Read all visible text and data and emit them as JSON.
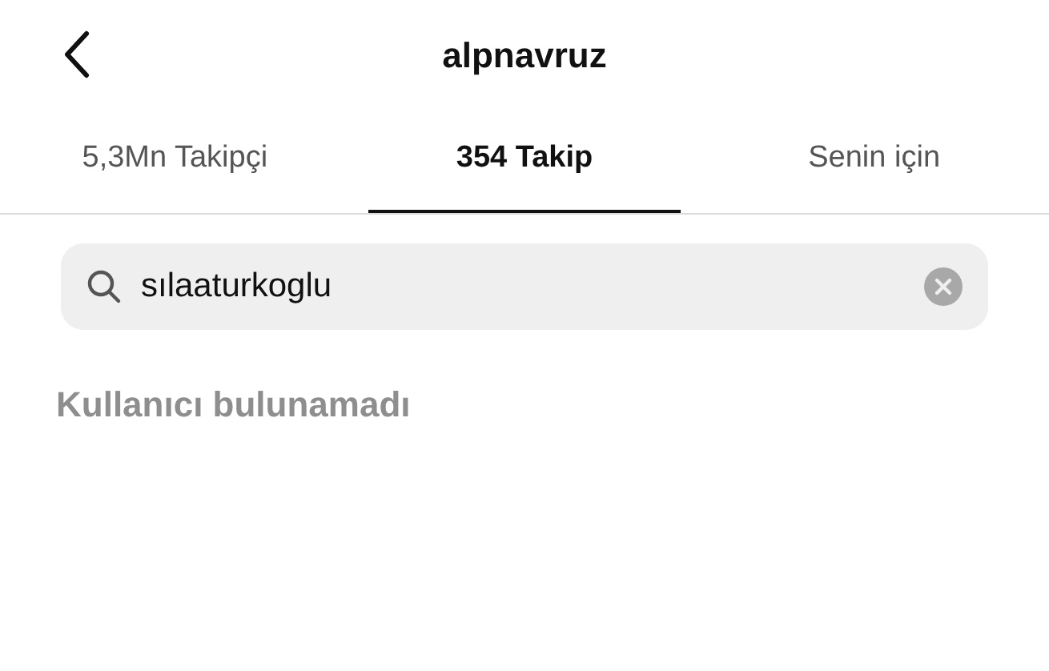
{
  "header": {
    "title": "alpnavruz"
  },
  "tabs": [
    {
      "label": "5,3Mn Takipçi",
      "selected": false
    },
    {
      "label": "354 Takip",
      "selected": true
    },
    {
      "label": "Senin için",
      "selected": false
    }
  ],
  "search": {
    "value": "sılaaturkoglu"
  },
  "message": "Kullanıcı bulunamadı"
}
